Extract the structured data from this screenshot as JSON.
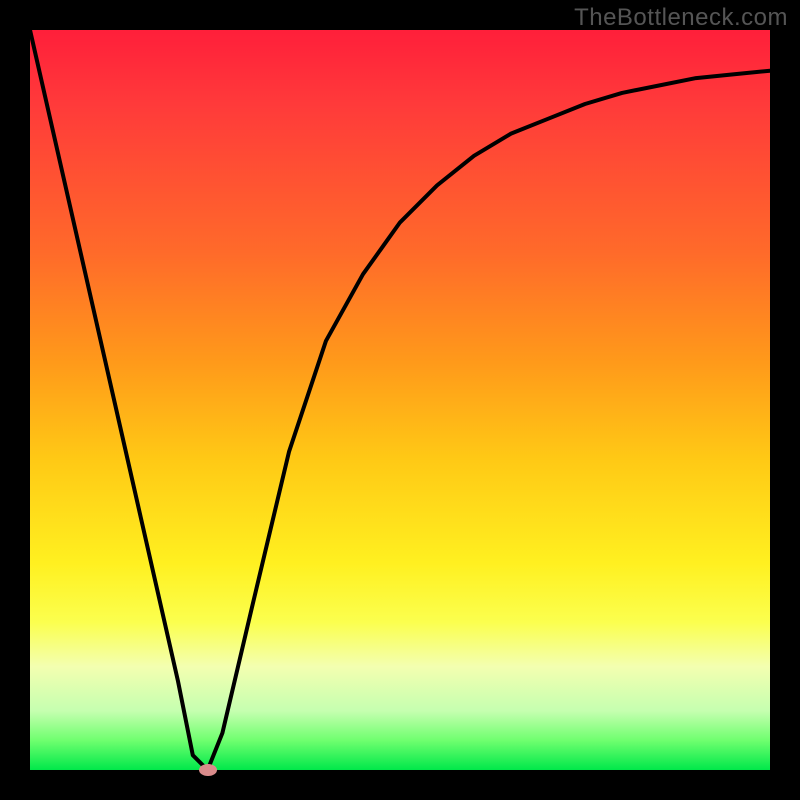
{
  "watermark": "TheBottleneck.com",
  "chart_data": {
    "type": "line",
    "title": "",
    "xlabel": "",
    "ylabel": "",
    "xlim": [
      0,
      100
    ],
    "ylim": [
      0,
      100
    ],
    "background_gradient": {
      "direction": "top-to-bottom",
      "stops": [
        {
          "pos": 0,
          "color": "#ff1f3a",
          "meaning": "high-bottleneck"
        },
        {
          "pos": 50,
          "color": "#ffb015",
          "meaning": "moderate"
        },
        {
          "pos": 80,
          "color": "#fbff4e",
          "meaning": "low"
        },
        {
          "pos": 100,
          "color": "#00e84a",
          "meaning": "optimal"
        }
      ]
    },
    "series": [
      {
        "name": "bottleneck-curve",
        "x": [
          0,
          5,
          10,
          15,
          20,
          22,
          24,
          26,
          30,
          35,
          40,
          45,
          50,
          55,
          60,
          65,
          70,
          75,
          80,
          85,
          90,
          95,
          100
        ],
        "y": [
          100,
          78,
          56,
          34,
          12,
          2,
          0,
          5,
          22,
          43,
          58,
          67,
          74,
          79,
          83,
          86,
          88,
          90,
          91.5,
          92.5,
          93.5,
          94,
          94.5
        ]
      }
    ],
    "marker": {
      "x": 24,
      "y": 0,
      "color": "#d98b8b"
    },
    "colors": {
      "curve": "#000000",
      "frame": "#000000"
    }
  }
}
